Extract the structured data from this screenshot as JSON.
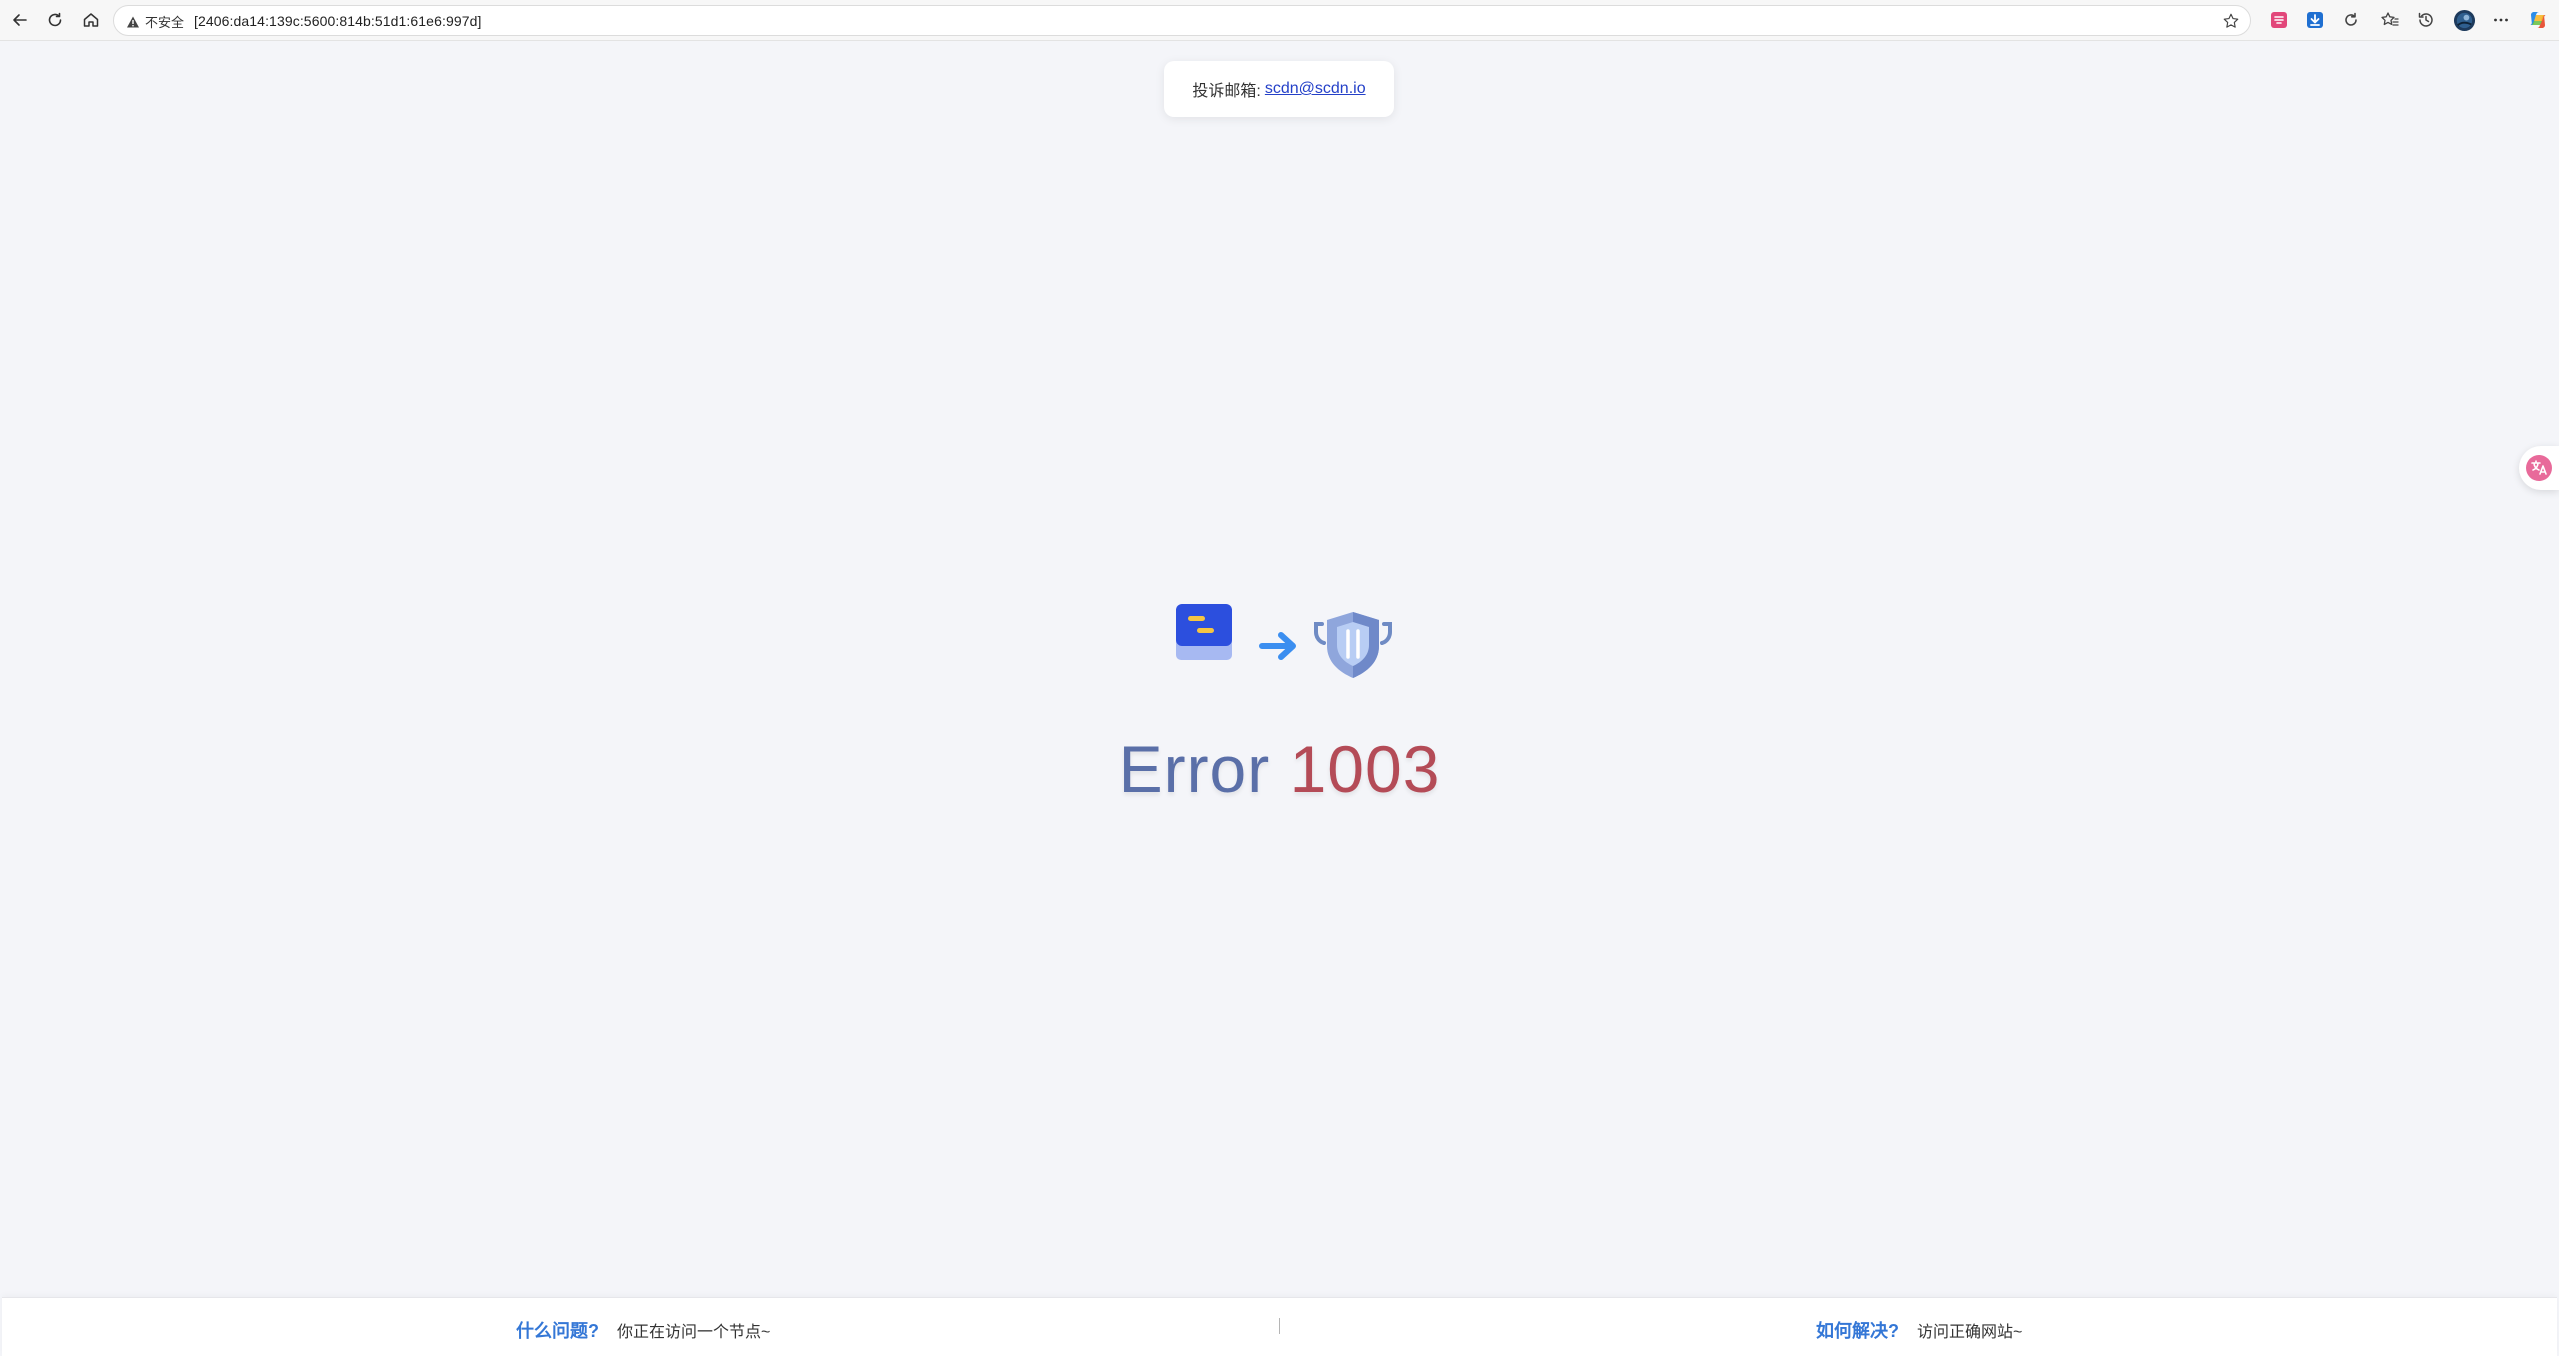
{
  "browser": {
    "security_label": "不安全",
    "url": "[2406:da14:139c:5600:814b:51d1:61e6:997d]"
  },
  "page": {
    "complaint": {
      "label": "投诉邮箱:",
      "email": "scdn@scdn.io"
    },
    "error": {
      "word": "Error",
      "code": "1003"
    },
    "footer": {
      "left": {
        "question": "什么问题?",
        "answer": "你正在访问一个节点~"
      },
      "right": {
        "question": "如何解决?",
        "answer": "访问正确网站~"
      }
    }
  },
  "colors": {
    "accent_blue": "#3477d6",
    "error_word": "#5a6fa8",
    "error_code": "#b44b57",
    "link": "#2440c8",
    "background": "#f4f5f9"
  },
  "icons": {
    "toolbar": [
      "back-icon",
      "reload-icon",
      "home-icon",
      "warning-icon",
      "star-icon"
    ],
    "extensions": [
      "extension-pink-icon",
      "extension-download-icon",
      "refresh-extension-icon",
      "favorites-icon",
      "history-icon",
      "profile-avatar-icon",
      "more-icon",
      "copilot-icon"
    ],
    "hero": [
      "server-card-icon",
      "arrow-right-icon",
      "shield-icon"
    ],
    "side": "translate-float-icon"
  }
}
